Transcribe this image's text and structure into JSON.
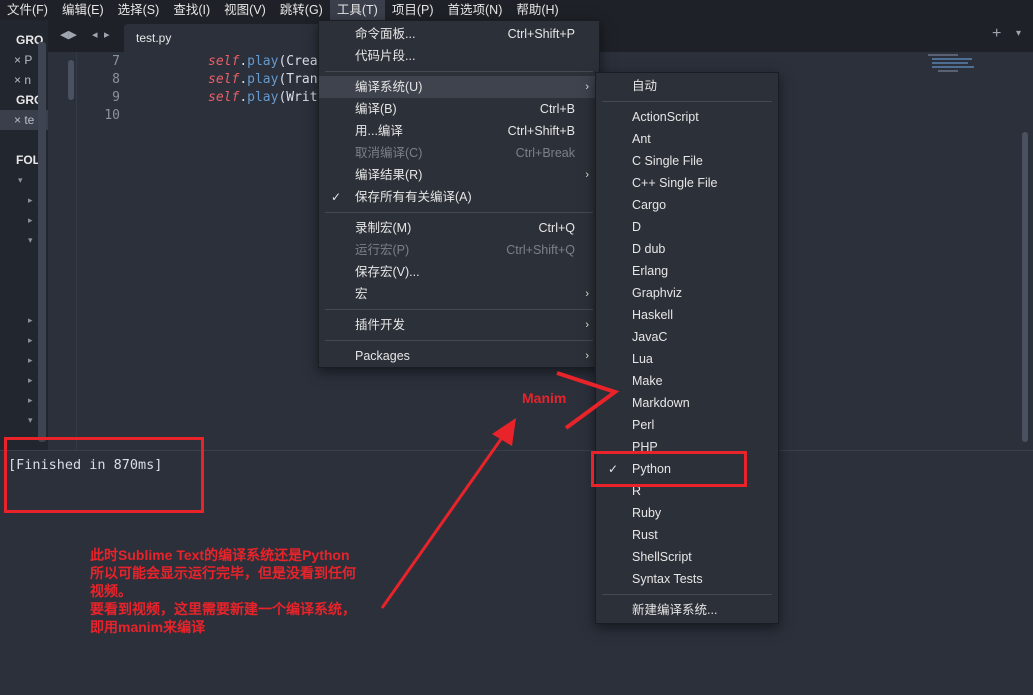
{
  "menubar": {
    "items": [
      "文件(F)",
      "编辑(E)",
      "选择(S)",
      "查找(I)",
      "视图(V)",
      "跳转(G)",
      "工具(T)",
      "项目(P)",
      "首选项(N)",
      "帮助(H)"
    ],
    "active_index": 6
  },
  "sidebar": {
    "rows": [
      {
        "kind": "group",
        "text": "GRO"
      },
      {
        "kind": "file",
        "text": "× P"
      },
      {
        "kind": "file",
        "text": "× n"
      },
      {
        "kind": "group",
        "text": "GRO"
      },
      {
        "kind": "file",
        "text": "× te"
      },
      {
        "kind": "group",
        "text": "FOL"
      }
    ]
  },
  "tabs": {
    "active": {
      "label": "test.py",
      "close": "×"
    },
    "nav": [
      "◂",
      "▸"
    ],
    "add": "+",
    "dropdown": "▾"
  },
  "editor": {
    "lines": [
      {
        "num": "7",
        "self": "self",
        "dot": ".",
        "fn": "play",
        "rest": "(Crea"
      },
      {
        "num": "8",
        "self": "self",
        "dot": ".",
        "fn": "play",
        "rest": "(Tran"
      },
      {
        "num": "9",
        "self": "self",
        "dot": ".",
        "fn": "play",
        "rest": "(Writ"
      },
      {
        "num": "10",
        "self": "",
        "dot": "",
        "fn": "",
        "rest": ""
      }
    ]
  },
  "output": {
    "text": "[Finished in 870ms]"
  },
  "tools_menu": {
    "items": [
      {
        "label": "命令面板...",
        "shortcut": "Ctrl+Shift+P"
      },
      {
        "label": "代码片段...",
        "shortcut": ""
      },
      {
        "sep": true
      },
      {
        "label": "编译系统(U)",
        "shortcut": "",
        "submenu": true,
        "highlight": true
      },
      {
        "label": "编译(B)",
        "shortcut": "Ctrl+B"
      },
      {
        "label": "用...编译",
        "shortcut": "Ctrl+Shift+B"
      },
      {
        "label": "取消编译(C)",
        "shortcut": "Ctrl+Break",
        "disabled": true
      },
      {
        "label": "编译结果(R)",
        "shortcut": "",
        "submenu": true
      },
      {
        "label": "保存所有有关编译(A)",
        "shortcut": "",
        "checked": true
      },
      {
        "sep": true
      },
      {
        "label": "录制宏(M)",
        "shortcut": "Ctrl+Q"
      },
      {
        "label": "运行宏(P)",
        "shortcut": "Ctrl+Shift+Q",
        "disabled": true
      },
      {
        "label": "保存宏(V)...",
        "shortcut": ""
      },
      {
        "label": "宏",
        "shortcut": "",
        "submenu": true
      },
      {
        "sep": true
      },
      {
        "label": "插件开发",
        "shortcut": "",
        "submenu": true
      },
      {
        "sep": true
      },
      {
        "label": "Packages",
        "shortcut": "",
        "submenu": true
      }
    ]
  },
  "build_menu": {
    "items": [
      {
        "label": "自动"
      },
      {
        "sep": true
      },
      {
        "label": "ActionScript"
      },
      {
        "label": "Ant"
      },
      {
        "label": "C Single File"
      },
      {
        "label": "C++ Single File"
      },
      {
        "label": "Cargo"
      },
      {
        "label": "D"
      },
      {
        "label": "D dub"
      },
      {
        "label": "Erlang"
      },
      {
        "label": "Graphviz"
      },
      {
        "label": "Haskell"
      },
      {
        "label": "JavaC"
      },
      {
        "label": "Lua"
      },
      {
        "label": "Make"
      },
      {
        "label": "Markdown"
      },
      {
        "label": "Perl"
      },
      {
        "label": "PHP"
      },
      {
        "label": "Python",
        "checked": true
      },
      {
        "label": "R"
      },
      {
        "label": "Ruby"
      },
      {
        "label": "Rust"
      },
      {
        "label": "ShellScript"
      },
      {
        "label": "Syntax Tests"
      },
      {
        "sep": true
      },
      {
        "label": "新建编译系统..."
      }
    ]
  },
  "annotations": {
    "manim_label": "Manim",
    "note": "此时Sublime Text的编译系统还是Python\n所以可能会显示运行完毕，但是没看到任何\n视频。\n要看到视频，这里需要新建一个编译系统，\n即用manim来编译",
    "color": "#e8232a"
  },
  "icons": {
    "check": "✓",
    "submenu_arrow": "›",
    "collapse_arrow": "▾",
    "expand_arrow": "▸"
  }
}
